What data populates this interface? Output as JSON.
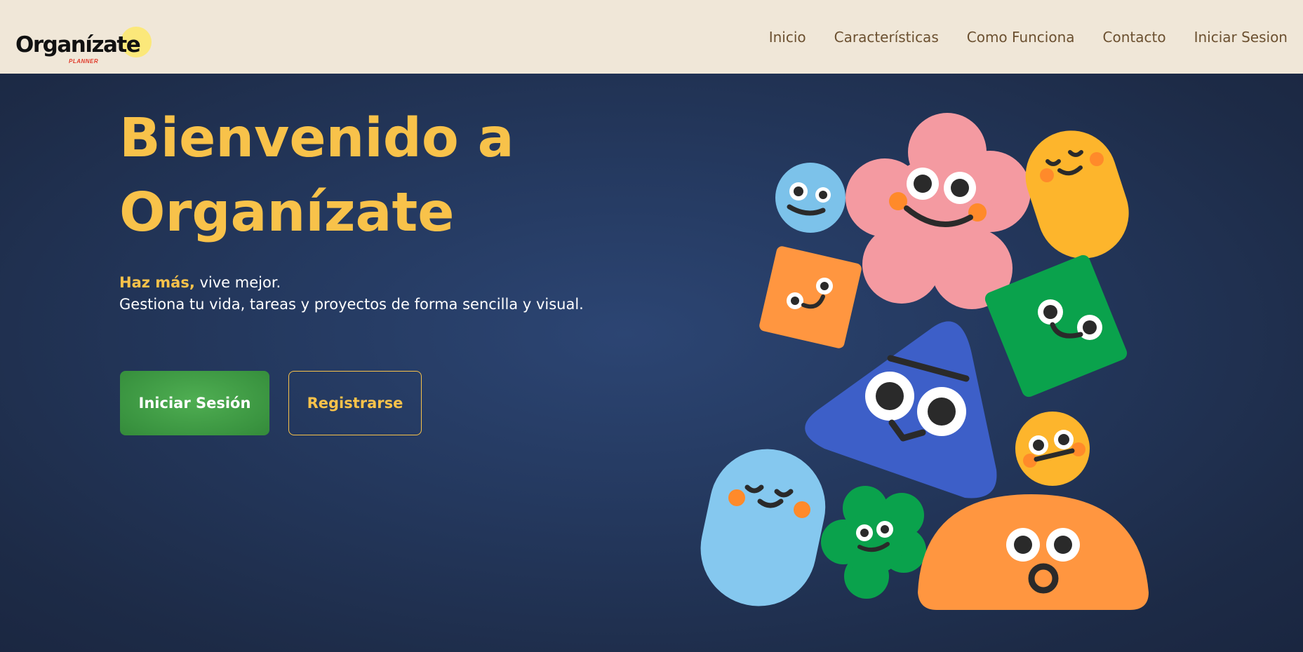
{
  "brand": {
    "name": "Organízate",
    "tagline": "PLANNER"
  },
  "nav": {
    "items": [
      "Inicio",
      "Características",
      "Como Funciona",
      "Contacto",
      "Iniciar Sesion"
    ]
  },
  "hero": {
    "title_line1": "Bienvenido a",
    "title_line2": "Organízate",
    "tag_accent": "Haz más,",
    "tag_rest": " vive mejor.",
    "description": "Gestiona tu vida, tareas y proyectos de forma sencilla y visual.",
    "login_button": "Iniciar Sesión",
    "register_button": "Registrarse"
  },
  "colors": {
    "nav_bg": "#f0e7d8",
    "hero_bg": "#253a61",
    "accent_yellow": "#f8c24a",
    "button_green": "#3a9440",
    "nav_text": "#6b5030"
  },
  "illustration": {
    "characters": [
      "flower-character",
      "blue-circle-character",
      "yellow-capsule-character",
      "orange-square-character",
      "green-square-character",
      "blue-triangle-character",
      "yellow-circle-character",
      "light-blue-capsule-character",
      "green-clover-character",
      "orange-dome-character"
    ]
  }
}
